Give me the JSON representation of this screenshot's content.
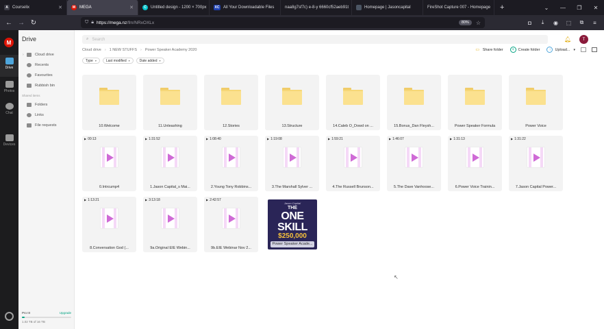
{
  "browser": {
    "tabs": [
      {
        "label": "Courselix",
        "fav_color": "#3b3b45",
        "fav_char": "A"
      },
      {
        "label": "MEGA",
        "fav_color": "#dd1405",
        "fav_char": "M"
      },
      {
        "label": "Untitled design - 1200 × 700px",
        "fav_color": "#00c4cc",
        "fav_char": "C"
      },
      {
        "label": "All Your Downloadable Files",
        "fav_color": "#1e40af",
        "fav_char": "XC"
      },
      {
        "label": "naa8g7sf7c) e-8-y 6660cf52aeb91t",
        "fav_color": "#2b2a33",
        "fav_char": ""
      },
      {
        "label": "Homepage | Jasoncapital",
        "fav_color": "#4b5563",
        "fav_char": ""
      },
      {
        "label": "FireShot Capture 007 - Homepage",
        "fav_color": "#2b2a33",
        "fav_char": ""
      }
    ],
    "url_host": "https://mega.nz",
    "url_path": "/fm/NRxOXLx",
    "zoom": "80%"
  },
  "rail": {
    "logo": "M",
    "items": [
      {
        "label": "Drive",
        "icon": "cloud-drive-icon"
      },
      {
        "label": "Photos",
        "icon": "photos-icon"
      },
      {
        "label": "Chat",
        "icon": "chat-icon"
      },
      {
        "label": "Devices",
        "icon": "devices-icon"
      }
    ]
  },
  "sidebar": {
    "title": "Drive",
    "items": [
      {
        "label": "Cloud drive",
        "icon": "cloud-icon"
      },
      {
        "label": "Recents",
        "icon": "clock-icon"
      },
      {
        "label": "Favourites",
        "icon": "heart-icon"
      },
      {
        "label": "Rubbish bin",
        "icon": "trash-icon"
      }
    ],
    "section_label": "Shared items",
    "shared_items": [
      {
        "label": "Folders",
        "icon": "shared-folder-icon"
      },
      {
        "label": "Links",
        "icon": "link-icon"
      },
      {
        "label": "File requests",
        "icon": "file-request-icon"
      }
    ],
    "storage": {
      "plan": "Pro III",
      "upgrade": "Upgrade",
      "used_fraction": 0.06,
      "usage": "1.02 TB of 16 TB"
    }
  },
  "search": {
    "placeholder": "Search"
  },
  "account": {
    "initial": "T"
  },
  "breadcrumb": [
    "Cloud drive",
    "1 NEW STUFFS",
    "Power Speaker Academy 2020"
  ],
  "actions": {
    "share": "Share folder",
    "create": "Create folder",
    "upload": "Upload..."
  },
  "filters": [
    "Type",
    "Last modified",
    "Date added"
  ],
  "folders": [
    {
      "name": "10.Welcome"
    },
    {
      "name": "11.Unleashing"
    },
    {
      "name": "12.Stories"
    },
    {
      "name": "13.Structure"
    },
    {
      "name": "14.Caleb O_Dowd on ..."
    },
    {
      "name": "15.Bonus_Dan Fleysh..."
    },
    {
      "name": "Power Speaker Formula"
    },
    {
      "name": "Power Voice"
    }
  ],
  "videos": [
    {
      "name": "0.Intrcump4",
      "duration": "00:13"
    },
    {
      "name": "1.Jason Capital_s Mai...",
      "duration": "1:31:52"
    },
    {
      "name": "2.Young Tony Robbins...",
      "duration": "1:08:40"
    },
    {
      "name": "3.The Marshall Sylver ...",
      "duration": "1:19:08"
    },
    {
      "name": "4.The Russell Brunson...",
      "duration": "1:59:21"
    },
    {
      "name": "5.The Dave Vanhoose...",
      "duration": "1:46:07"
    },
    {
      "name": "6.Power Voice Trainin...",
      "duration": "1:31:13"
    },
    {
      "name": "7.Jason Capital Power...",
      "duration": "1:31:22"
    },
    {
      "name": "8.Conversation God (...",
      "duration": "1:13:21"
    },
    {
      "name": "9a.Original EIE Webin...",
      "duration": "3:13:18"
    },
    {
      "name": "9b.EIE Webinar Nov 2...",
      "duration": "2:42:57"
    }
  ],
  "image_file": {
    "name": "Power Speaker Acade...",
    "thumb_signature": "Jason Capital",
    "thumb_line1": "THE",
    "thumb_line2": "ONE",
    "thumb_line3": "SKILL",
    "thumb_line4": "$250,000"
  }
}
